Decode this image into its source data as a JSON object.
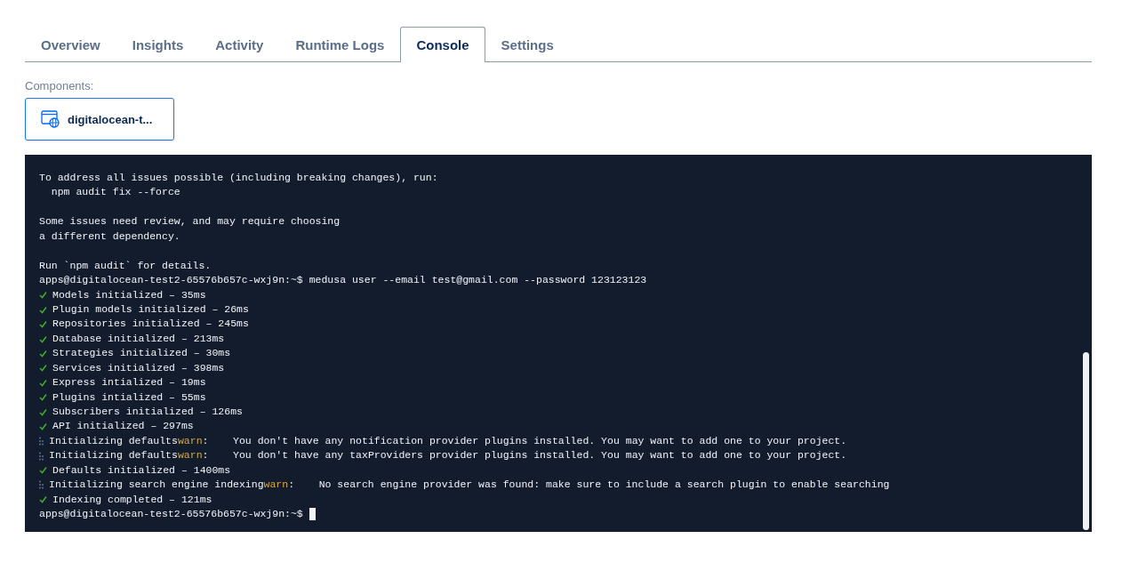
{
  "tabs": [
    {
      "label": "Overview",
      "selected": false
    },
    {
      "label": "Insights",
      "selected": false
    },
    {
      "label": "Activity",
      "selected": false
    },
    {
      "label": "Runtime Logs",
      "selected": false
    },
    {
      "label": "Console",
      "selected": true
    },
    {
      "label": "Settings",
      "selected": false
    }
  ],
  "components": {
    "label": "Components:",
    "items": [
      {
        "name": "digitalocean-t...",
        "selected": true
      }
    ]
  },
  "console": {
    "lines": [
      {
        "kind": "plain",
        "text": "To address all issues possible (including breaking changes), run:"
      },
      {
        "kind": "plain",
        "text": "  npm audit fix --force"
      },
      {
        "kind": "blank"
      },
      {
        "kind": "plain",
        "text": "Some issues need review, and may require choosing"
      },
      {
        "kind": "plain",
        "text": "a different dependency."
      },
      {
        "kind": "blank"
      },
      {
        "kind": "plain",
        "text": "Run `npm audit` for details."
      },
      {
        "kind": "plain",
        "text": "apps@digitalocean-test2-65576b657c-wxj9n:~$ medusa user --email test@gmail.com --password 123123123"
      },
      {
        "kind": "done",
        "text": "Models initialized – 35ms"
      },
      {
        "kind": "done",
        "text": "Plugin models initialized – 26ms"
      },
      {
        "kind": "done",
        "text": "Repositories initialized – 245ms"
      },
      {
        "kind": "done",
        "text": "Database initialized – 213ms"
      },
      {
        "kind": "done",
        "text": "Strategies initialized – 30ms"
      },
      {
        "kind": "done",
        "text": "Services initialized – 398ms"
      },
      {
        "kind": "done",
        "text": "Express intialized – 19ms"
      },
      {
        "kind": "done",
        "text": "Plugins intialized – 55ms"
      },
      {
        "kind": "done",
        "text": "Subscribers initialized – 126ms"
      },
      {
        "kind": "done",
        "text": "API initialized – 297ms"
      },
      {
        "kind": "pending",
        "text": "Initializing defaults",
        "tag": "warn",
        "message": ":    You don't have any notification provider plugins installed. You may want to add one to your project."
      },
      {
        "kind": "pending",
        "text": "Initializing defaults",
        "tag": "warn",
        "message": ":    You don't have any taxProviders provider plugins installed. You may want to add one to your project."
      },
      {
        "kind": "done",
        "text": "Defaults initialized – 1400ms"
      },
      {
        "kind": "pending",
        "text": "Initializing search engine indexing",
        "tag": "warn",
        "message": ":    No search engine provider was found: make sure to include a search plugin to enable searching"
      },
      {
        "kind": "done",
        "text": "Indexing completed – 121ms"
      },
      {
        "kind": "prompt",
        "text": "apps@digitalocean-test2-65576b657c-wxj9n:~$ "
      }
    ]
  }
}
